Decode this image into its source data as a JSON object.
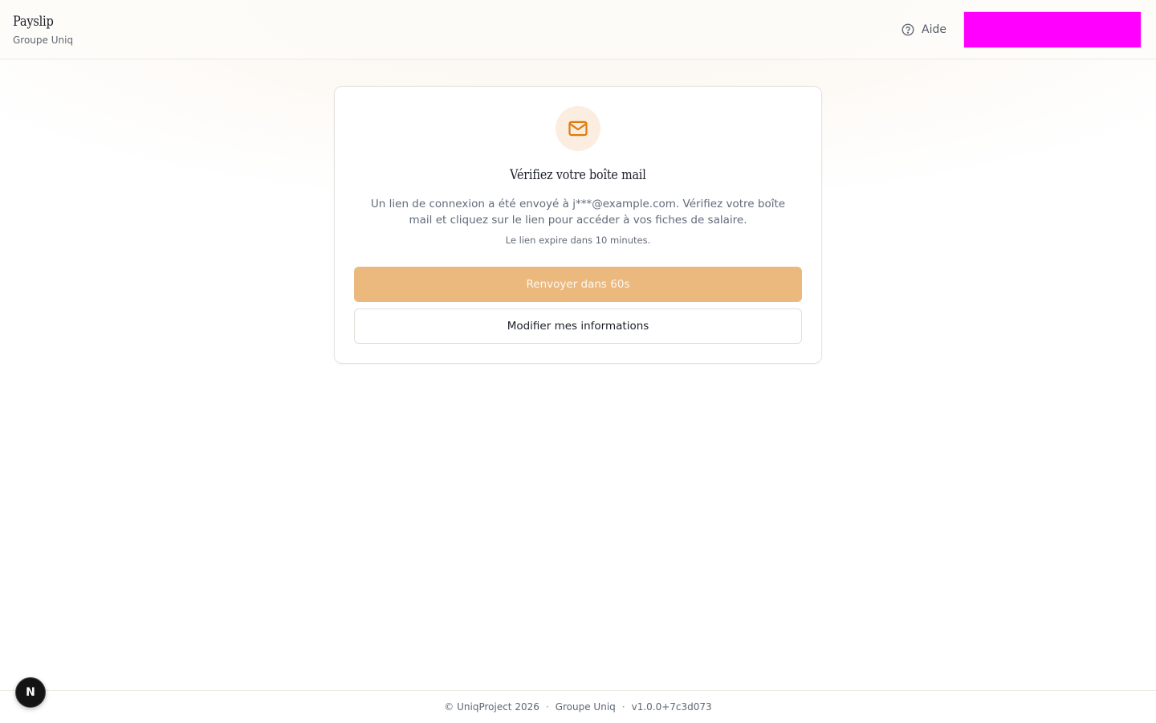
{
  "header": {
    "app_name": "Payslip",
    "org_name": "Groupe Uniq",
    "help_label": "Aide",
    "help_icon": "help-circle-icon",
    "slot_color": "#ff00ff"
  },
  "card": {
    "icon": "mail-icon",
    "title": "Vérifiez votre boîte mail",
    "description": "Un lien de connexion a été envoyé à j***@example.com. Vérifiez votre boîte mail et cliquez sur le lien pour accéder à vos fiches de salaire.",
    "note": "Le lien expire dans 10 minutes.",
    "resend_label": "Renvoyer dans 60s",
    "modify_label": "Modifier mes informations"
  },
  "footer": {
    "copyright": "© UniqProject 2026",
    "separator": "·",
    "org": "Groupe Uniq",
    "version": "v1.0.0+7c3d073"
  },
  "dev_badge": {
    "label": "N"
  },
  "colors": {
    "accent": "#e07b12",
    "button_disabled": "#ebb97e",
    "icon_bg": "#fbeee0"
  }
}
